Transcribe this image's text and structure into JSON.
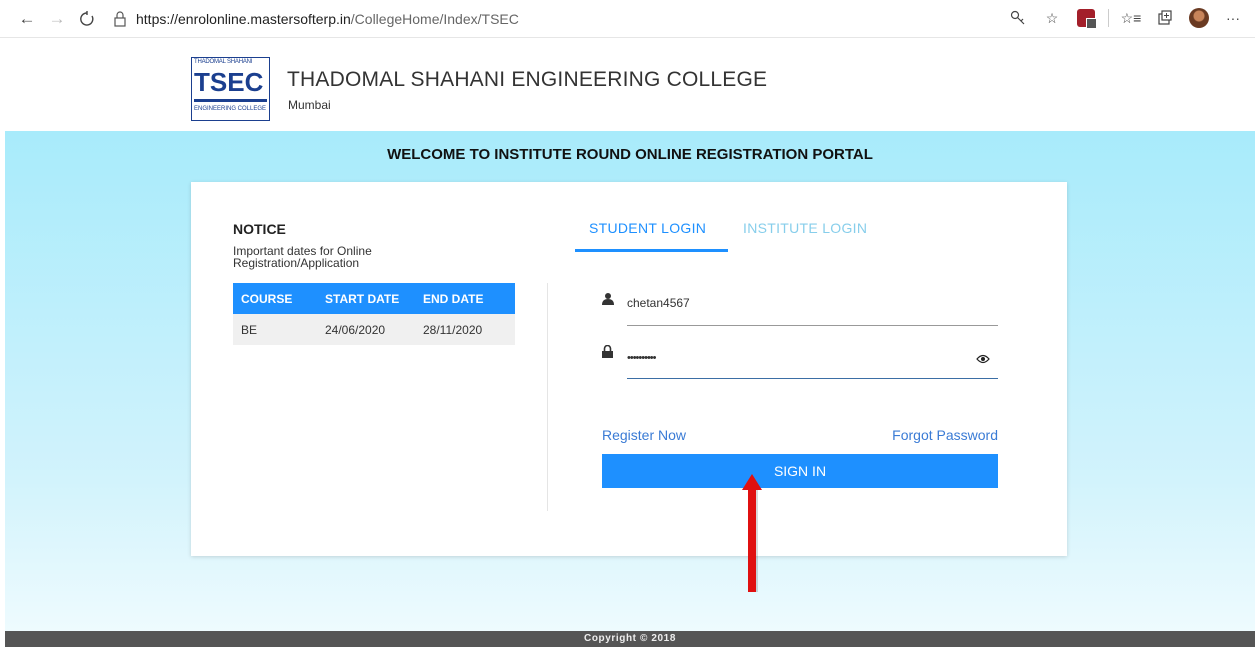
{
  "browser": {
    "url_host": "https://enrolonline.mastersofterp.in",
    "url_path": "/CollegeHome/Index/TSEC",
    "icons": [
      "back-icon",
      "forward-icon",
      "refresh-icon",
      "lock-icon",
      "key-icon",
      "star-icon",
      "extension-icon",
      "favorites-icon",
      "collections-icon",
      "profile-avatar",
      "more-icon"
    ]
  },
  "header": {
    "logo_top": "THADOMAL SHAHANI",
    "logo_main": "TSEC",
    "logo_bottom": "ENGINEERING COLLEGE",
    "college_name": "THADOMAL SHAHANI ENGINEERING COLLEGE",
    "city": "Mumbai"
  },
  "main": {
    "welcome": "WELCOME TO INSTITUTE ROUND ONLINE REGISTRATION PORTAL"
  },
  "notice": {
    "title": "NOTICE",
    "subtitle": "Important dates for Online Registration/Application",
    "columns": [
      "COURSE",
      "START DATE",
      "END DATE"
    ],
    "rows": [
      [
        "BE",
        "24/06/2020",
        "28/11/2020"
      ]
    ]
  },
  "login": {
    "tabs": [
      "STUDENT LOGIN",
      "INSTITUTE LOGIN"
    ],
    "active_tab": "STUDENT LOGIN",
    "username_value": "chetan4567",
    "password_value": "••••••••••",
    "register_label": "Register Now",
    "forgot_label": "Forgot Password",
    "signin_label": "SIGN IN"
  },
  "footer": {
    "copyright": "Copyright © 2018"
  },
  "colors": {
    "accent": "#1e90ff",
    "inactive_tab": "#87ceeb",
    "background_top": "#a8ebfb",
    "arrow": "#e01010",
    "footer": "#555555"
  }
}
